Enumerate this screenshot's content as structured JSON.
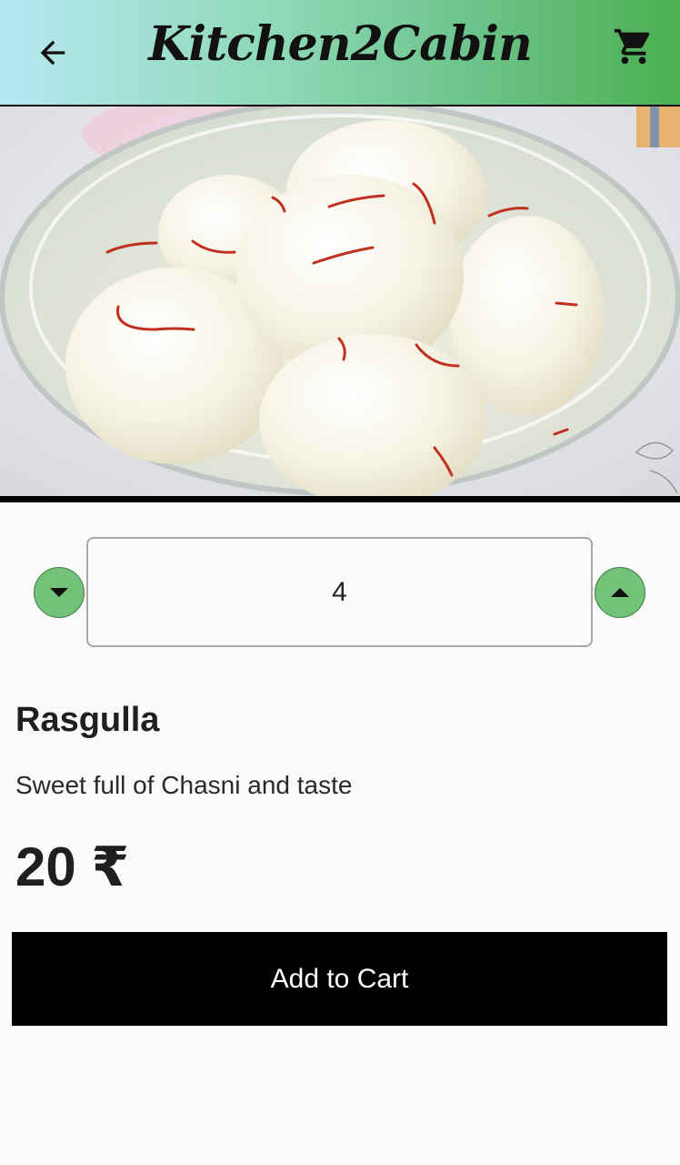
{
  "appbar": {
    "title": "Kitchen2Cabin",
    "back_icon": "arrow-back-icon",
    "cart_icon": "shopping-cart-icon",
    "gradient": [
      "#b7e8f2",
      "#4caf50"
    ]
  },
  "hero": {
    "alt": "Rasgulla in a glass bowl"
  },
  "quantity": {
    "value": "4",
    "decrement_icon": "chevron-down-icon",
    "increment_icon": "chevron-up-icon",
    "button_color": "#74c17a"
  },
  "product": {
    "name": "Rasgulla",
    "description": "Sweet full of Chasni and taste",
    "price": "20 ₹"
  },
  "actions": {
    "add_to_cart": "Add to Cart"
  }
}
